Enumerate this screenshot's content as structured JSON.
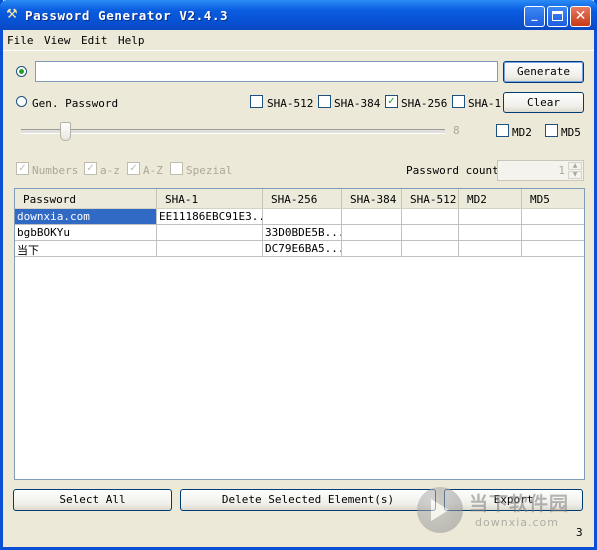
{
  "window": {
    "title": "Password Generator V2.4.3"
  },
  "menu": {
    "items": [
      "File",
      "View",
      "Edit",
      "Help"
    ]
  },
  "input": {
    "value": ""
  },
  "buttons": {
    "generate": "Generate",
    "clear": "Clear",
    "select_all": "Select All",
    "delete_selected": "Delete Selected Element(s)",
    "export": "Export"
  },
  "gen_password": {
    "label": "Gen. Password",
    "length_value": "8"
  },
  "hash_options_row1": [
    {
      "label": "SHA-512",
      "checked": false
    },
    {
      "label": "SHA-384",
      "checked": false
    },
    {
      "label": "SHA-256",
      "checked": true
    },
    {
      "label": "SHA-1",
      "checked": false
    }
  ],
  "hash_options_row2": [
    {
      "label": "MD2",
      "checked": false
    },
    {
      "label": "MD5",
      "checked": false
    }
  ],
  "charset": [
    {
      "label": "Numbers",
      "checked": true
    },
    {
      "label": "a-z",
      "checked": true
    },
    {
      "label": "A-Z",
      "checked": true
    },
    {
      "label": "Spezial",
      "checked": false
    }
  ],
  "password_count": {
    "label": "Password count",
    "value": "1"
  },
  "table": {
    "columns": [
      "Password",
      "SHA-1",
      "SHA-256",
      "SHA-384",
      "SHA-512",
      "MD2",
      "MD5"
    ],
    "rows": [
      [
        "downxia.com",
        "EE11186EBC91E3...",
        "",
        "",
        "",
        "",
        ""
      ],
      [
        "bgbBOKYu",
        "",
        "33D0BDE5B...",
        "",
        "",
        "",
        ""
      ],
      [
        "当下",
        "",
        "DC79E6BA5...",
        "",
        "",
        "",
        ""
      ]
    ]
  },
  "watermark": {
    "cn": "当下软件园",
    "en": "downxia.com"
  },
  "corner_number": "3"
}
